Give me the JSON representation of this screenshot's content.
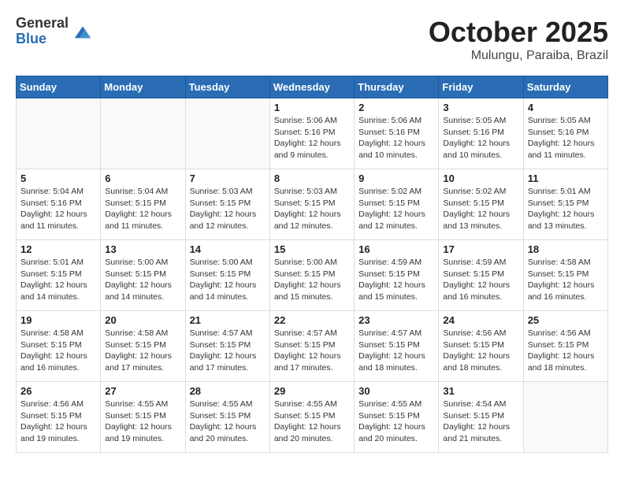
{
  "header": {
    "logo_general": "General",
    "logo_blue": "Blue",
    "month_title": "October 2025",
    "location": "Mulungu, Paraiba, Brazil"
  },
  "weekdays": [
    "Sunday",
    "Monday",
    "Tuesday",
    "Wednesday",
    "Thursday",
    "Friday",
    "Saturday"
  ],
  "weeks": [
    [
      {
        "day": "",
        "info": ""
      },
      {
        "day": "",
        "info": ""
      },
      {
        "day": "",
        "info": ""
      },
      {
        "day": "1",
        "info": "Sunrise: 5:06 AM\nSunset: 5:16 PM\nDaylight: 12 hours\nand 9 minutes."
      },
      {
        "day": "2",
        "info": "Sunrise: 5:06 AM\nSunset: 5:16 PM\nDaylight: 12 hours\nand 10 minutes."
      },
      {
        "day": "3",
        "info": "Sunrise: 5:05 AM\nSunset: 5:16 PM\nDaylight: 12 hours\nand 10 minutes."
      },
      {
        "day": "4",
        "info": "Sunrise: 5:05 AM\nSunset: 5:16 PM\nDaylight: 12 hours\nand 11 minutes."
      }
    ],
    [
      {
        "day": "5",
        "info": "Sunrise: 5:04 AM\nSunset: 5:16 PM\nDaylight: 12 hours\nand 11 minutes."
      },
      {
        "day": "6",
        "info": "Sunrise: 5:04 AM\nSunset: 5:15 PM\nDaylight: 12 hours\nand 11 minutes."
      },
      {
        "day": "7",
        "info": "Sunrise: 5:03 AM\nSunset: 5:15 PM\nDaylight: 12 hours\nand 12 minutes."
      },
      {
        "day": "8",
        "info": "Sunrise: 5:03 AM\nSunset: 5:15 PM\nDaylight: 12 hours\nand 12 minutes."
      },
      {
        "day": "9",
        "info": "Sunrise: 5:02 AM\nSunset: 5:15 PM\nDaylight: 12 hours\nand 12 minutes."
      },
      {
        "day": "10",
        "info": "Sunrise: 5:02 AM\nSunset: 5:15 PM\nDaylight: 12 hours\nand 13 minutes."
      },
      {
        "day": "11",
        "info": "Sunrise: 5:01 AM\nSunset: 5:15 PM\nDaylight: 12 hours\nand 13 minutes."
      }
    ],
    [
      {
        "day": "12",
        "info": "Sunrise: 5:01 AM\nSunset: 5:15 PM\nDaylight: 12 hours\nand 14 minutes."
      },
      {
        "day": "13",
        "info": "Sunrise: 5:00 AM\nSunset: 5:15 PM\nDaylight: 12 hours\nand 14 minutes."
      },
      {
        "day": "14",
        "info": "Sunrise: 5:00 AM\nSunset: 5:15 PM\nDaylight: 12 hours\nand 14 minutes."
      },
      {
        "day": "15",
        "info": "Sunrise: 5:00 AM\nSunset: 5:15 PM\nDaylight: 12 hours\nand 15 minutes."
      },
      {
        "day": "16",
        "info": "Sunrise: 4:59 AM\nSunset: 5:15 PM\nDaylight: 12 hours\nand 15 minutes."
      },
      {
        "day": "17",
        "info": "Sunrise: 4:59 AM\nSunset: 5:15 PM\nDaylight: 12 hours\nand 16 minutes."
      },
      {
        "day": "18",
        "info": "Sunrise: 4:58 AM\nSunset: 5:15 PM\nDaylight: 12 hours\nand 16 minutes."
      }
    ],
    [
      {
        "day": "19",
        "info": "Sunrise: 4:58 AM\nSunset: 5:15 PM\nDaylight: 12 hours\nand 16 minutes."
      },
      {
        "day": "20",
        "info": "Sunrise: 4:58 AM\nSunset: 5:15 PM\nDaylight: 12 hours\nand 17 minutes."
      },
      {
        "day": "21",
        "info": "Sunrise: 4:57 AM\nSunset: 5:15 PM\nDaylight: 12 hours\nand 17 minutes."
      },
      {
        "day": "22",
        "info": "Sunrise: 4:57 AM\nSunset: 5:15 PM\nDaylight: 12 hours\nand 17 minutes."
      },
      {
        "day": "23",
        "info": "Sunrise: 4:57 AM\nSunset: 5:15 PM\nDaylight: 12 hours\nand 18 minutes."
      },
      {
        "day": "24",
        "info": "Sunrise: 4:56 AM\nSunset: 5:15 PM\nDaylight: 12 hours\nand 18 minutes."
      },
      {
        "day": "25",
        "info": "Sunrise: 4:56 AM\nSunset: 5:15 PM\nDaylight: 12 hours\nand 18 minutes."
      }
    ],
    [
      {
        "day": "26",
        "info": "Sunrise: 4:56 AM\nSunset: 5:15 PM\nDaylight: 12 hours\nand 19 minutes."
      },
      {
        "day": "27",
        "info": "Sunrise: 4:55 AM\nSunset: 5:15 PM\nDaylight: 12 hours\nand 19 minutes."
      },
      {
        "day": "28",
        "info": "Sunrise: 4:55 AM\nSunset: 5:15 PM\nDaylight: 12 hours\nand 20 minutes."
      },
      {
        "day": "29",
        "info": "Sunrise: 4:55 AM\nSunset: 5:15 PM\nDaylight: 12 hours\nand 20 minutes."
      },
      {
        "day": "30",
        "info": "Sunrise: 4:55 AM\nSunset: 5:15 PM\nDaylight: 12 hours\nand 20 minutes."
      },
      {
        "day": "31",
        "info": "Sunrise: 4:54 AM\nSunset: 5:15 PM\nDaylight: 12 hours\nand 21 minutes."
      },
      {
        "day": "",
        "info": ""
      }
    ]
  ]
}
